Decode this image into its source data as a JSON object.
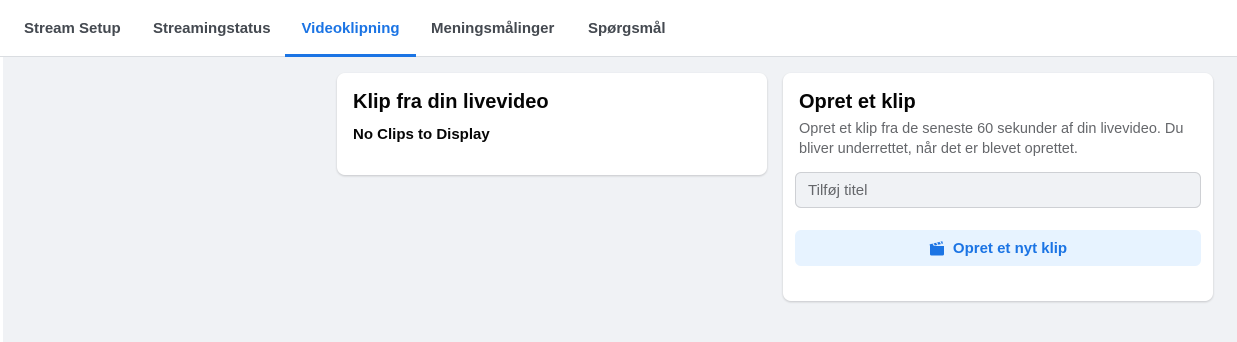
{
  "tabs": [
    {
      "label": "Stream Setup",
      "active": false
    },
    {
      "label": "Streamingstatus",
      "active": false
    },
    {
      "label": "Videoklipning",
      "active": true
    },
    {
      "label": "Meningsmålinger",
      "active": false
    },
    {
      "label": "Spørgsmål",
      "active": false
    }
  ],
  "clips_card": {
    "title": "Klip fra din livevideo",
    "empty_text": "No Clips to Display"
  },
  "create_card": {
    "title": "Opret et klip",
    "description": "Opret et klip fra de seneste 60 sekunder af din livevideo. Du bliver underrettet, når det er blevet oprettet.",
    "title_input": {
      "value": "",
      "placeholder": "Tilføj titel"
    },
    "button_label": "Opret et nyt klip",
    "button_icon": "clapperboard-icon"
  },
  "colors": {
    "accent": "#1b74e4",
    "button_bg": "#e7f3ff",
    "page_bg": "#f0f2f5"
  }
}
